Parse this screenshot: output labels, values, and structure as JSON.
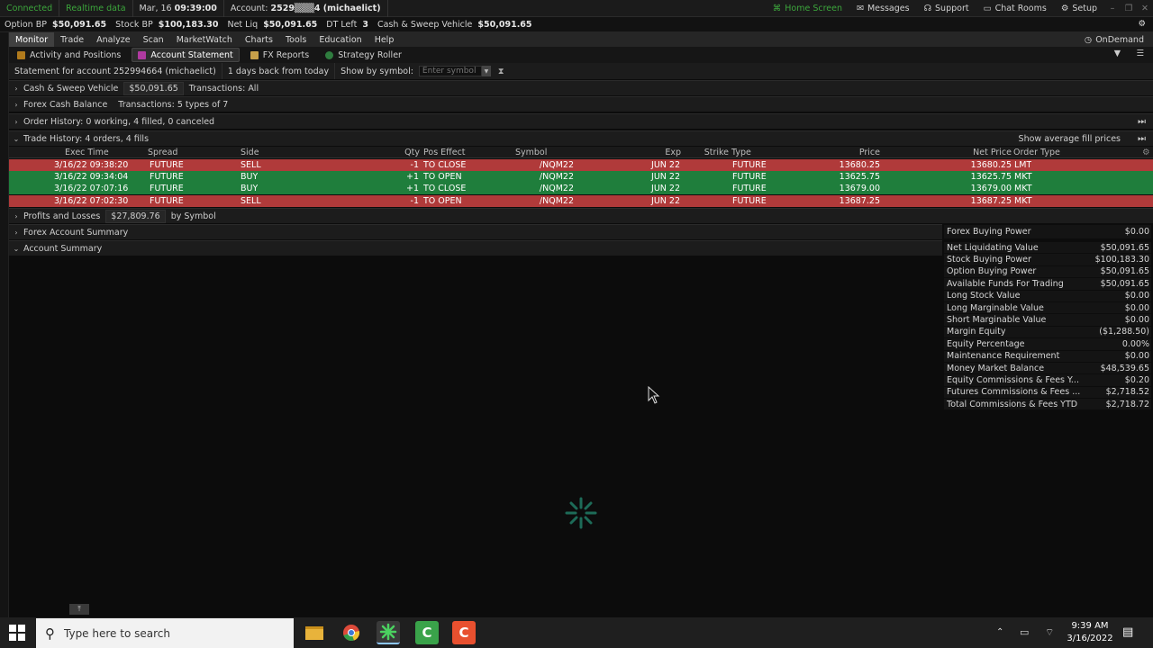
{
  "topbar": {
    "connected": "Connected",
    "realtime": "Realtime data",
    "date": "Mar, 16",
    "time": "09:39:00",
    "account_label": "Account:",
    "account_value": "2529▒▒▒4 (michaelict)",
    "home_screen": "Home Screen",
    "messages": "Messages",
    "support": "Support",
    "chat_rooms": "Chat Rooms",
    "setup": "Setup"
  },
  "statbar": [
    {
      "label": "Option BP",
      "value": "$50,091.65"
    },
    {
      "label": "Stock BP",
      "value": "$100,183.30"
    },
    {
      "label": "Net Liq",
      "value": "$50,091.65"
    },
    {
      "label": "DT Left",
      "value": "3"
    },
    {
      "label": "Cash & Sweep Vehicle",
      "value": "$50,091.65"
    }
  ],
  "menu": {
    "items": [
      "Monitor",
      "Trade",
      "Analyze",
      "Scan",
      "MarketWatch",
      "Charts",
      "Tools",
      "Education",
      "Help"
    ],
    "ondemand": "OnDemand"
  },
  "subtabs": [
    "Activity and Positions",
    "Account Statement",
    "FX Reports",
    "Strategy Roller"
  ],
  "controls": {
    "statement_for": "Statement for account 252994664 (michaelict)",
    "days_back": "1 days back from today",
    "show_by_symbol": "Show by symbol:",
    "symbol_placeholder": "Enter symbol"
  },
  "sections": {
    "cash_sweep": {
      "title": "Cash & Sweep Vehicle",
      "value": "$50,091.65",
      "filter": "Transactions: All"
    },
    "forex_cash": {
      "title": "Forex Cash Balance",
      "filter": "Transactions: 5 types of 7"
    },
    "order_history": {
      "title": "Order History: 0 working, 4 filled, 0 canceled"
    },
    "trade_history": {
      "title": "Trade History: 4 orders, 4 fills",
      "right_label": "Show average fill prices"
    },
    "pnl": {
      "title": "Profits and Losses",
      "value": "$27,809.76",
      "by": "by Symbol"
    },
    "forex_summary": {
      "title": "Forex Account Summary"
    },
    "account_summary": {
      "title": "Account Summary"
    }
  },
  "trade_table": {
    "headers": [
      "Exec Time",
      "Spread",
      "Side",
      "Qty",
      "Pos Effect",
      "Symbol",
      "Exp",
      "Strike",
      "Type",
      "Price",
      "Net Price",
      "Order Type"
    ],
    "rows": [
      {
        "time": "3/16/22 09:38:20",
        "spread": "FUTURE",
        "side": "SELL",
        "qty": "-1",
        "pos": "TO CLOSE",
        "symbol": "/NQM22",
        "exp": "JUN 22",
        "strike": "",
        "type": "FUTURE",
        "price": "13680.25",
        "net": "13680.25",
        "otype": "LMT",
        "kind": "sell"
      },
      {
        "time": "3/16/22 09:34:04",
        "spread": "FUTURE",
        "side": "BUY",
        "qty": "+1",
        "pos": "TO OPEN",
        "symbol": "/NQM22",
        "exp": "JUN 22",
        "strike": "",
        "type": "FUTURE",
        "price": "13625.75",
        "net": "13625.75",
        "otype": "MKT",
        "kind": "buy"
      },
      {
        "time": "3/16/22 07:07:16",
        "spread": "FUTURE",
        "side": "BUY",
        "qty": "+1",
        "pos": "TO CLOSE",
        "symbol": "/NQM22",
        "exp": "JUN 22",
        "strike": "",
        "type": "FUTURE",
        "price": "13679.00",
        "net": "13679.00",
        "otype": "MKT",
        "kind": "buy"
      },
      {
        "time": "3/16/22 07:02:30",
        "spread": "FUTURE",
        "side": "SELL",
        "qty": "-1",
        "pos": "TO OPEN",
        "symbol": "/NQM22",
        "exp": "JUN 22",
        "strike": "",
        "type": "FUTURE",
        "price": "13687.25",
        "net": "13687.25",
        "otype": "MKT",
        "kind": "sell"
      }
    ]
  },
  "account_summary": [
    {
      "label": "Forex Buying Power",
      "value": "$0.00"
    },
    {
      "label": "Net Liquidating Value",
      "value": "$50,091.65"
    },
    {
      "label": "Stock Buying Power",
      "value": "$100,183.30"
    },
    {
      "label": "Option Buying Power",
      "value": "$50,091.65"
    },
    {
      "label": "Available Funds For Trading",
      "value": "$50,091.65"
    },
    {
      "label": "Long Stock Value",
      "value": "$0.00"
    },
    {
      "label": "Long Marginable Value",
      "value": "$0.00"
    },
    {
      "label": "Short Marginable Value",
      "value": "$0.00"
    },
    {
      "label": "Margin Equity",
      "value": "($1,288.50)"
    },
    {
      "label": "Equity Percentage",
      "value": "0.00%"
    },
    {
      "label": "Maintenance Requirement",
      "value": "$0.00"
    },
    {
      "label": "Money Market Balance",
      "value": "$48,539.65"
    },
    {
      "label": "Equity Commissions & Fees Y...",
      "value": "$0.20"
    },
    {
      "label": "Futures Commissions & Fees ...",
      "value": "$2,718.52"
    },
    {
      "label": "Total Commissions & Fees YTD",
      "value": "$2,718.72"
    }
  ],
  "taskbar": {
    "search_placeholder": "Type here to search",
    "clock_time": "9:39 AM",
    "clock_date": "3/16/2022"
  },
  "colors": {
    "sell_row": "#b03a3a",
    "buy_row": "#1f7e3c",
    "connected": "#3ca63c"
  }
}
